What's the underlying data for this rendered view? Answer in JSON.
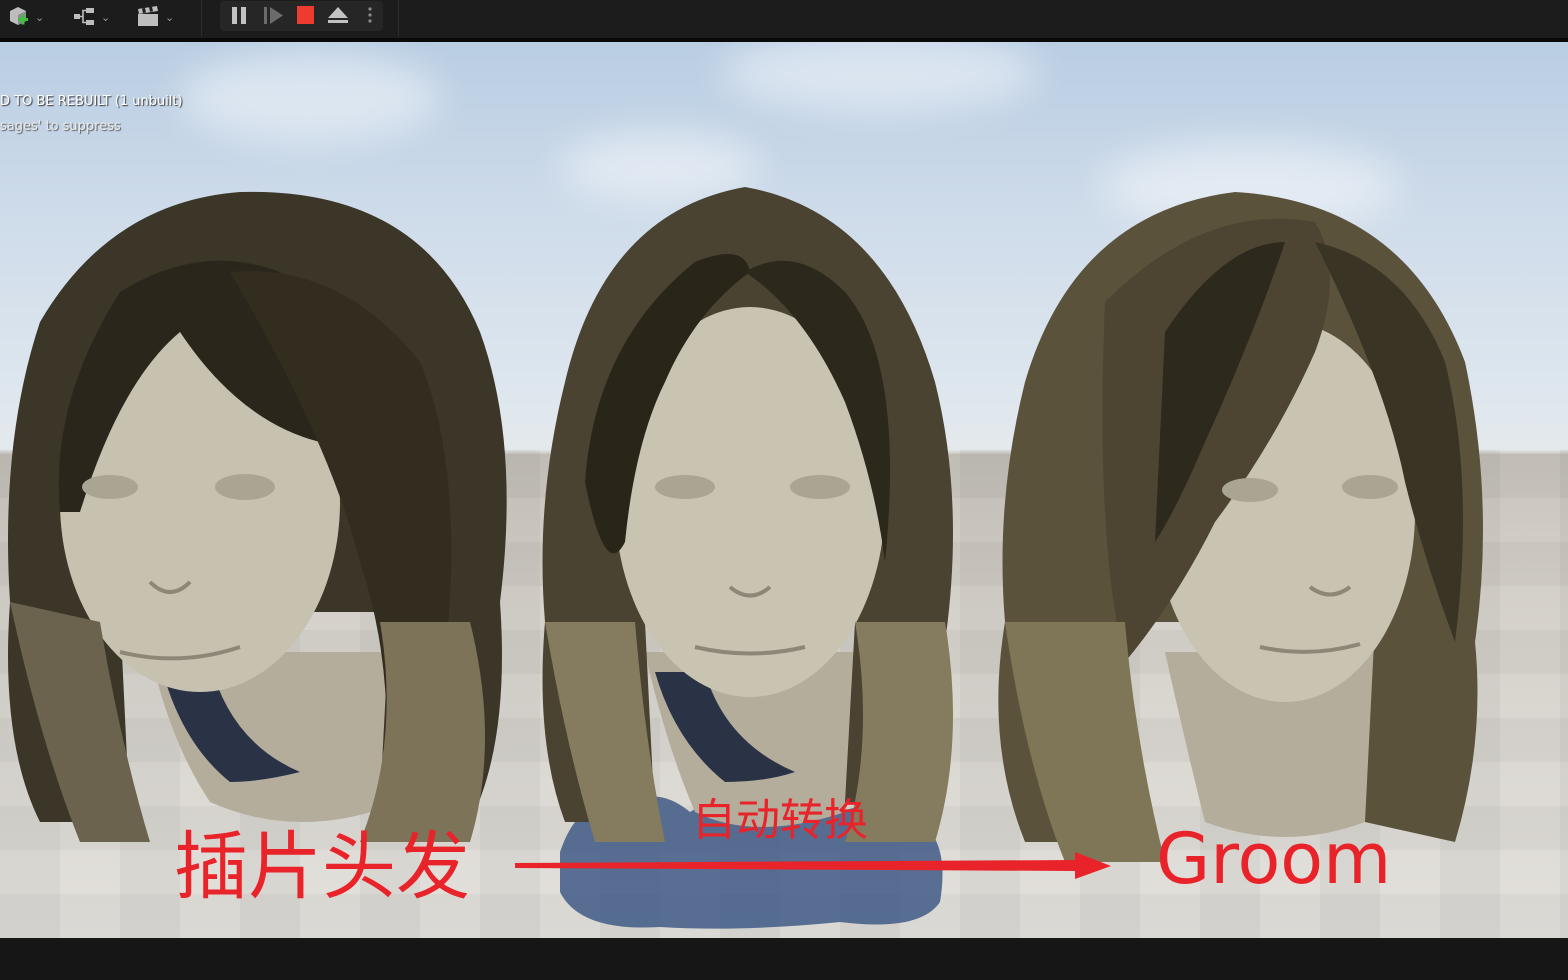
{
  "toolbar": {
    "icons": [
      "add-actor-icon",
      "blueprint-icon",
      "cinematics-icon",
      "pause-icon",
      "step-icon",
      "stop-icon",
      "eject-icon",
      "more-icon"
    ],
    "stop_color": "#ee3b2f"
  },
  "viewport": {
    "warning_line1": "D TO BE REBUILT (1 unbuilt)",
    "warning_line2": "sages' to suppress"
  },
  "annotations": {
    "left_label": "插片头发",
    "middle_label": "自动转换",
    "right_label": "Groom",
    "arrow_color": "#e8232a"
  }
}
